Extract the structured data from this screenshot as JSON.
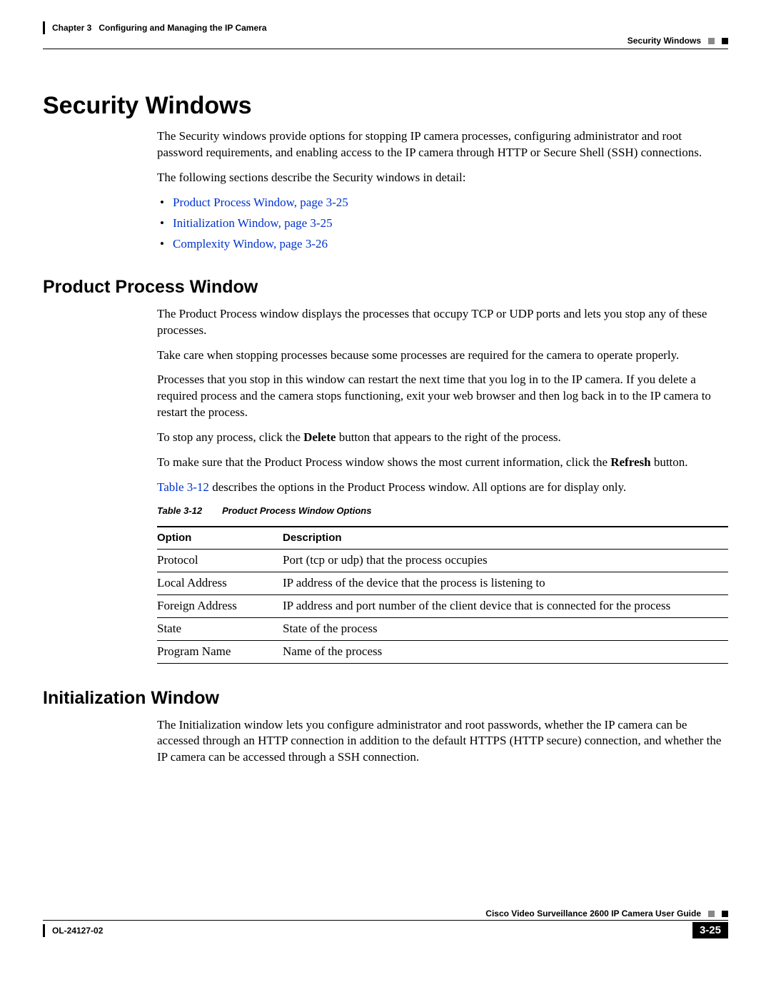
{
  "header": {
    "chapter": "Chapter 3",
    "chapter_title": "Configuring and Managing the IP Camera",
    "section": "Security Windows"
  },
  "main_heading": "Security Windows",
  "intro": {
    "p1": "The Security windows provide options for stopping IP camera processes, configuring administrator and root password requirements, and enabling access to the IP camera through HTTP or Secure Shell (SSH) connections.",
    "p2": "The following sections describe the Security windows in detail:"
  },
  "links": [
    "Product Process Window, page 3-25",
    "Initialization Window, page 3-25",
    "Complexity Window, page 3-26"
  ],
  "product_process": {
    "heading": "Product Process Window",
    "p1": "The Product Process window displays the processes that occupy TCP or UDP ports and lets you stop any of these processes.",
    "p2": "Take care when stopping processes because some processes are required for the camera to operate properly.",
    "p3": "Processes that you stop in this window can restart the next time that you log in to the IP camera. If you delete a required process and the camera stops functioning, exit your web browser and then log back in to the IP camera to restart the process.",
    "p4a": "To stop any process, click the ",
    "p4b": "Delete",
    "p4c": " button that appears to the right of the process.",
    "p5a": "To make sure that the Product Process window shows the most current information, click the ",
    "p5b": "Refresh",
    "p5c": " button.",
    "p6a": "Table 3-12",
    "p6b": " describes the options in the Product Process window. All options are for display only."
  },
  "table": {
    "label": "Table 3-12",
    "title": "Product Process Window Options",
    "col1": "Option",
    "col2": "Description",
    "rows": [
      {
        "opt": "Protocol",
        "desc": "Port (tcp or udp) that the process occupies"
      },
      {
        "opt": "Local Address",
        "desc": "IP address of the device that the process is listening to"
      },
      {
        "opt": "Foreign Address",
        "desc": "IP address and port number of the client device that is connected for the process"
      },
      {
        "opt": "State",
        "desc": "State of the process"
      },
      {
        "opt": "Program Name",
        "desc": "Name of the process"
      }
    ]
  },
  "initialization": {
    "heading": "Initialization Window",
    "p1": "The Initialization window lets you configure administrator and root passwords, whether the IP camera can be accessed through an HTTP connection in addition to the default HTTPS (HTTP secure) connection, and whether the IP camera can be accessed through a SSH connection."
  },
  "footer": {
    "guide": "Cisco Video Surveillance 2600 IP Camera User Guide",
    "doc_id": "OL-24127-02",
    "page": "3-25"
  }
}
